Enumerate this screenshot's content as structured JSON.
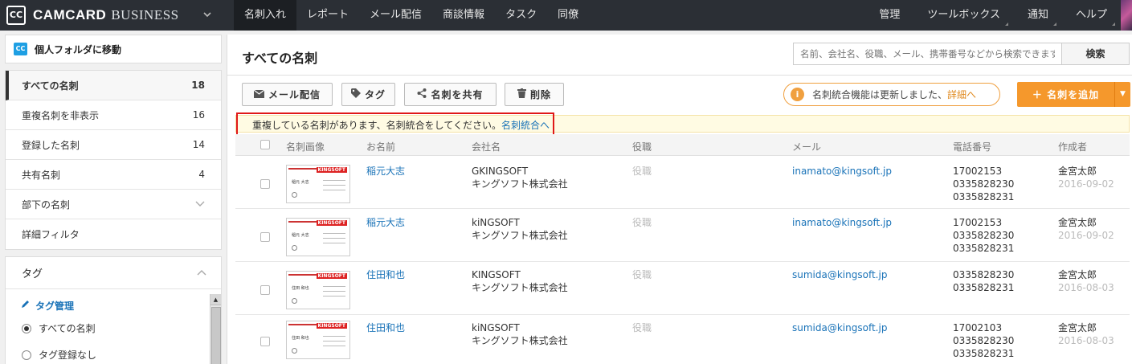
{
  "app": {
    "logo_mark": "CC",
    "logo_text": "CAMCARD",
    "logo_sub": "BUSINESS",
    "nav_left": [
      "名刺入れ",
      "レポート",
      "メール配信",
      "商談情報",
      "タスク",
      "同僚"
    ],
    "nav_right": [
      "管理",
      "ツールボックス",
      "通知",
      "ヘルプ"
    ]
  },
  "sidebar": {
    "goto_personal": "個人フォルダに移動",
    "goto_badge": "CC",
    "menu": [
      {
        "label": "すべての名刺",
        "count": "18"
      },
      {
        "label": "重複名刺を非表示",
        "count": "16"
      },
      {
        "label": "登録した名刺",
        "count": "14"
      },
      {
        "label": "共有名刺",
        "count": "4"
      },
      {
        "label": "部下の名刺",
        "count": ""
      },
      {
        "label": "詳細フィルタ",
        "count": ""
      }
    ],
    "tags_title": "タグ",
    "tag_manage": "タグ管理",
    "tag_options": [
      "すべての名刺",
      "タグ登録なし"
    ]
  },
  "main": {
    "title": "すべての名刺",
    "search_placeholder": "名前、会社名、役職、メール、携帯番号などから検索できます",
    "search_button": "検索",
    "toolbar": {
      "mail": "メール配信",
      "tag": "タグ",
      "share": "名刺を共有",
      "delete": "削除"
    },
    "notice_text": "名刺統合機能は更新しました、",
    "notice_link": "詳細へ",
    "add_button": "＋ 名刺を追加",
    "dup_text": "重複している名刺があります、名刺統合をしてください。",
    "dup_link": "名刺統合へ",
    "columns": [
      "名刺画像",
      "お名前",
      "会社名",
      "役職",
      "メール",
      "電話番号",
      "作成者"
    ],
    "rows": [
      {
        "name": "稲元大志",
        "company1": "GKINGSOFT",
        "company2": "キングソフト株式会社",
        "title": "役職",
        "email": "inamato@kingsoft.jp",
        "phone1": "17002153",
        "phone2": "0335828230",
        "phone3": "0335828231",
        "creator": "金宮太郎",
        "date": "2016-09-02",
        "card_name": "稲元 大志"
      },
      {
        "name": "稲元大志",
        "company1": "kiNGSOFT",
        "company2": "キングソフト株式会社",
        "title": "役職",
        "email": "inamato@kingsoft.jp",
        "phone1": "17002153",
        "phone2": "0335828230",
        "phone3": "0335828231",
        "creator": "金宮太郎",
        "date": "2016-09-02",
        "card_name": "稲元 大志"
      },
      {
        "name": "住田和也",
        "company1": "KINGSOFT",
        "company2": "キングソフト株式会社",
        "title": "役職",
        "email": "sumida@kingsoft.jp",
        "phone1": "0335828230",
        "phone2": "0335828231",
        "phone3": "",
        "creator": "金宮太郎",
        "date": "2016-08-03",
        "card_name": "住田 和也"
      },
      {
        "name": "住田和也",
        "company1": "kiNGSOFT",
        "company2": "キングソフト株式会社",
        "title": "役職",
        "email": "sumida@kingsoft.jp",
        "phone1": "17002103",
        "phone2": "0335828230",
        "phone3": "0335828231",
        "creator": "金宮太郎",
        "date": "2016-08-03",
        "card_name": "住田 和也"
      }
    ],
    "card_logo": "KINGSOFT"
  }
}
